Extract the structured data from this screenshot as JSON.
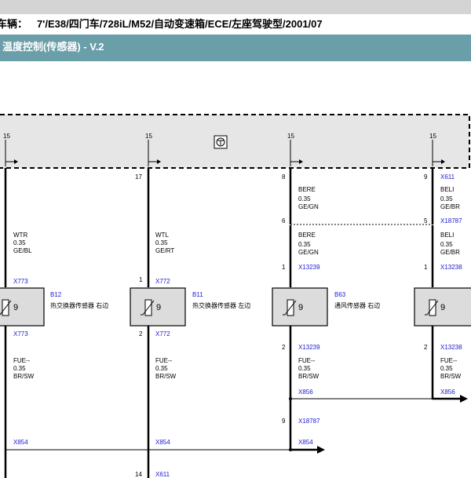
{
  "header": {
    "vehicle_label": "车辆：",
    "vehicle_value": "7'/E38/四门车/728iL/M52/自动变速箱/ECE/左座驾驶型/2001/07",
    "title": "温度控制(传感器) - V.2"
  },
  "diagram": {
    "module_pin": "15",
    "columns": [
      {
        "top_pin": "15",
        "wire_upper": {
          "name": "WTR",
          "size": "0.35",
          "color": "GE/BL"
        },
        "conn_upper": "X773",
        "sensor_id": "B12",
        "sensor_desc": "热交换器传感器 右边",
        "sensor_symbol": "9",
        "conn_lower": "X773",
        "wire_lower": {
          "name": "FUE--",
          "size": "0.35",
          "color": "BR/SW"
        },
        "bus_connector": "X854"
      },
      {
        "top_pin": "15",
        "module_pin_no": "17",
        "wire_upper": {
          "name": "WTL",
          "size": "0.35",
          "color": "GE/RT"
        },
        "upper_pin": "1",
        "conn_upper": "X772",
        "sensor_id": "B11",
        "sensor_desc": "热交换器传感器 左边",
        "sensor_symbol": "9",
        "lower_pin": "2",
        "conn_lower": "X772",
        "wire_lower": {
          "name": "FUE--",
          "size": "0.35",
          "color": "BR/SW"
        },
        "bus_connector": "X854",
        "bottom_pin": "14",
        "bottom_connector": "X611"
      },
      {
        "top_pin": "15",
        "module_pin_no": "8",
        "wire_top": {
          "name": "BERE",
          "size": "0.35",
          "color": "GE/GN"
        },
        "splice_pin": "6",
        "wire_upper": {
          "name": "BERE",
          "size": "0.35",
          "color": "GE/GN"
        },
        "upper_pin": "1",
        "conn_upper": "X13239",
        "sensor_id": "B63",
        "sensor_desc": "通风传感器 右边",
        "sensor_symbol": "9",
        "lower_pin": "2",
        "conn_lower": "X13239",
        "wire_lower": {
          "name": "FUE--",
          "size": "0.35",
          "color": "BR/SW"
        },
        "bus_connector": "X856",
        "splice2_pin": "9",
        "splice2_connector": "X18787",
        "bus2_connector": "X854"
      },
      {
        "top_pin": "15",
        "module_pin_no": "9",
        "module_connector": "X611",
        "wire_top": {
          "name": "BELI",
          "size": "0.35",
          "color": "GE/BR"
        },
        "splice_connector": "X18787",
        "splice_pin": "5",
        "wire_upper": {
          "name": "BELI",
          "size": "0.35",
          "color": "GE/BR"
        },
        "upper_pin": "1",
        "conn_upper": "X13238",
        "sensor_symbol": "9",
        "lower_pin": "2",
        "conn_lower": "X13238",
        "wire_lower": {
          "name": "FUE--",
          "size": "0.35",
          "color": "BR/SW"
        },
        "bus_connector": "X856"
      }
    ]
  },
  "colors": {
    "title_bar": "#6a9ea8",
    "top_bar": "#d4d4d4",
    "module_fill": "#e6e6e6",
    "sensor_fill": "#dcdcdc",
    "connector_text": "#1a1acc"
  }
}
